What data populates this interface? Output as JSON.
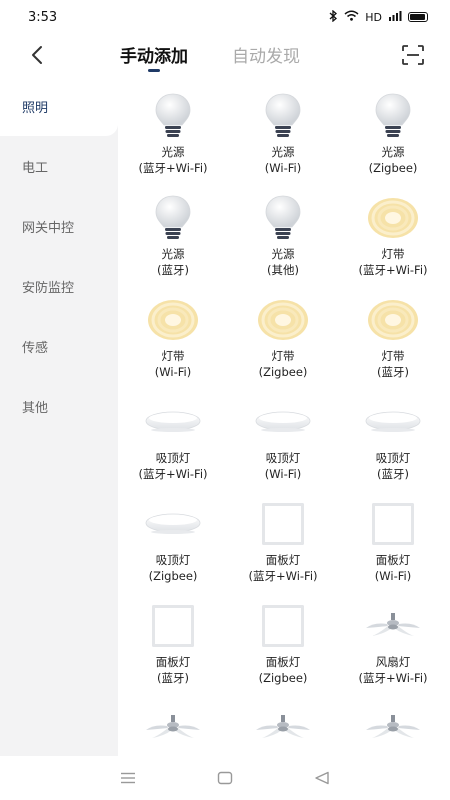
{
  "status": {
    "time": "3:53",
    "network": "HD",
    "signal": "⁴G"
  },
  "header": {
    "tabs": [
      {
        "label": "手动添加"
      },
      {
        "label": "自动发现"
      }
    ]
  },
  "sidebar": {
    "items": [
      {
        "label": "照明"
      },
      {
        "label": "电工"
      },
      {
        "label": "网关中控"
      },
      {
        "label": "安防监控"
      },
      {
        "label": "传感"
      },
      {
        "label": "其他"
      }
    ]
  },
  "devices": [
    {
      "name": "光源",
      "sub": "(蓝牙+Wi-Fi)",
      "icon": "bulb-icon"
    },
    {
      "name": "光源",
      "sub": "(Wi-Fi)",
      "icon": "bulb-icon"
    },
    {
      "name": "光源",
      "sub": "(Zigbee)",
      "icon": "bulb-icon"
    },
    {
      "name": "光源",
      "sub": "(蓝牙)",
      "icon": "bulb-icon"
    },
    {
      "name": "光源",
      "sub": "(其他)",
      "icon": "bulb-icon"
    },
    {
      "name": "灯带",
      "sub": "(蓝牙+Wi-Fi)",
      "icon": "light-strip-icon"
    },
    {
      "name": "灯带",
      "sub": "(Wi-Fi)",
      "icon": "light-strip-icon"
    },
    {
      "name": "灯带",
      "sub": "(Zigbee)",
      "icon": "light-strip-icon"
    },
    {
      "name": "灯带",
      "sub": "(蓝牙)",
      "icon": "light-strip-icon"
    },
    {
      "name": "吸顶灯",
      "sub": "(蓝牙+Wi-Fi)",
      "icon": "ceiling-light-icon"
    },
    {
      "name": "吸顶灯",
      "sub": "(Wi-Fi)",
      "icon": "ceiling-light-icon"
    },
    {
      "name": "吸顶灯",
      "sub": "(蓝牙)",
      "icon": "ceiling-light-icon"
    },
    {
      "name": "吸顶灯",
      "sub": "(Zigbee)",
      "icon": "ceiling-light-icon"
    },
    {
      "name": "面板灯",
      "sub": "(蓝牙+Wi-Fi)",
      "icon": "panel-light-icon"
    },
    {
      "name": "面板灯",
      "sub": "(Wi-Fi)",
      "icon": "panel-light-icon"
    },
    {
      "name": "面板灯",
      "sub": "(蓝牙)",
      "icon": "panel-light-icon"
    },
    {
      "name": "面板灯",
      "sub": "(Zigbee)",
      "icon": "panel-light-icon"
    },
    {
      "name": "风扇灯",
      "sub": "(蓝牙+Wi-Fi)",
      "icon": "fan-light-icon"
    },
    {
      "name": "",
      "sub": "",
      "icon": "fan-light-icon"
    },
    {
      "name": "",
      "sub": "",
      "icon": "fan-light-icon"
    },
    {
      "name": "",
      "sub": "",
      "icon": "fan-light-icon"
    }
  ],
  "colors": {
    "accent": "#1f3a66",
    "sidebar_bg": "#f3f3f4",
    "strip": "#f6e2a8"
  }
}
